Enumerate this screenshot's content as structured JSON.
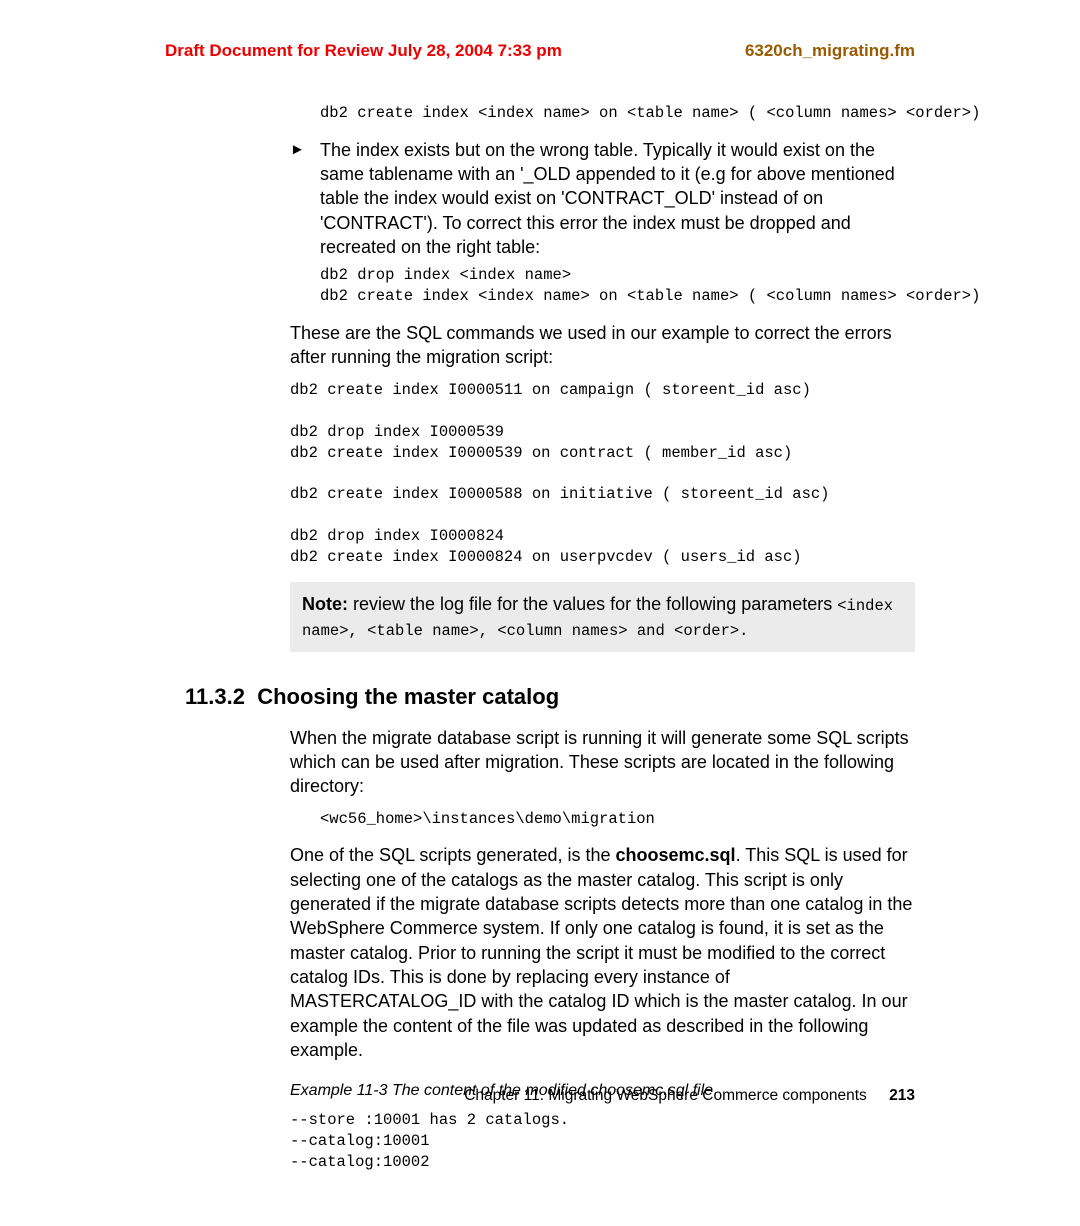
{
  "header": {
    "draft": "Draft Document for Review July 28, 2004 7:33 pm",
    "fm": "6320ch_migrating.fm"
  },
  "code1": "db2 create index <index name> on <table name> ( <column names> <order>)",
  "bullet1": "The index exists but on the wrong table. Typically it would exist on the same tablename with an '_OLD appended to it (e.g for above mentioned table the index would exist on 'CONTRACT_OLD' instead of on 'CONTRACT'). To correct this error the index must be dropped and recreated on the right table:",
  "code2": "db2 drop index <index name>\ndb2 create index <index name> on <table name> ( <column names> <order>)",
  "para1": "These are the SQL commands we used in our example to correct the errors after running the migration script:",
  "code3": "db2 create index I0000511 on campaign ( storeent_id asc)\n\ndb2 drop index I0000539\ndb2 create index I0000539 on contract ( member_id asc)\n\ndb2 create index I0000588 on initiative ( storeent_id asc)\n\ndb2 drop index I0000824\ndb2 create index I0000824 on userpvcdev ( users_id asc)",
  "note": {
    "label": "Note:",
    "text": " review the log file for the values for the following parameters ",
    "code": "<index name>, <table name>, <column names> and <order>."
  },
  "section": {
    "num": "11.3.2",
    "title": "Choosing the master catalog"
  },
  "para2": "When the migrate database script is running it will generate some SQL scripts which can be used after migration. These scripts are located in the following directory:",
  "code4": "<wc56_home>\\instances\\demo\\migration",
  "para3a": "One of the SQL scripts generated, is the ",
  "para3bold": "choosemc.sql",
  "para3b": ". This SQL is used for selecting one of the catalogs as the master catalog. This script is only generated if the migrate database scripts detects more than one catalog in the WebSphere Commerce system. If only one catalog is found, it is set as the master catalog. Prior to running the script it must be modified to the correct catalog IDs. This is done by replacing every instance of MASTERCATALOG_ID with the catalog ID which is the master catalog. In our example the content of the file was updated as described in the following example.",
  "example_caption": "Example 11-3   The content of the modified choosemc.sql file",
  "code5": "--store :10001 has 2 catalogs.\n--catalog:10001\n--catalog:10002",
  "footer": {
    "chapter": "Chapter 11. Migrating WebSphere Commerce components",
    "page": "213"
  }
}
